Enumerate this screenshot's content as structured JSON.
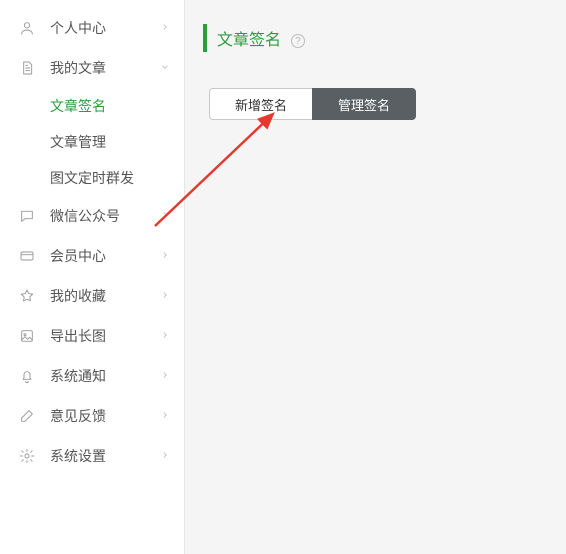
{
  "sidebar": {
    "items": [
      {
        "id": "personal-center",
        "label": "个人中心",
        "icon": "user",
        "chevron": "right",
        "sub": []
      },
      {
        "id": "my-articles",
        "label": "我的文章",
        "icon": "document",
        "chevron": "down",
        "sub": [
          {
            "id": "article-signature",
            "label": "文章签名",
            "active": true
          },
          {
            "id": "article-manage",
            "label": "文章管理",
            "active": false
          },
          {
            "id": "scheduled-mass",
            "label": "图文定时群发",
            "active": false
          }
        ]
      },
      {
        "id": "wechat-official",
        "label": "微信公众号",
        "icon": "chat",
        "chevron": "right",
        "sub": []
      },
      {
        "id": "member-center",
        "label": "会员中心",
        "icon": "card",
        "chevron": "right",
        "sub": []
      },
      {
        "id": "my-favorites",
        "label": "我的收藏",
        "icon": "star",
        "chevron": "right",
        "sub": []
      },
      {
        "id": "export-long-image",
        "label": "导出长图",
        "icon": "image",
        "chevron": "right",
        "sub": []
      },
      {
        "id": "system-notification",
        "label": "系统通知",
        "icon": "bell",
        "chevron": "right",
        "sub": []
      },
      {
        "id": "feedback",
        "label": "意见反馈",
        "icon": "edit",
        "chevron": "right",
        "sub": []
      },
      {
        "id": "system-settings",
        "label": "系统设置",
        "icon": "gear",
        "chevron": "right",
        "sub": []
      }
    ]
  },
  "main": {
    "page_title": "文章签名",
    "help_symbol": "?",
    "tab_add": "新增签名",
    "tab_manage": "管理签名"
  },
  "icons": {
    "user": "user-icon",
    "document": "document-icon",
    "chat": "chat-icon",
    "card": "card-icon",
    "star": "star-icon",
    "image": "image-icon",
    "bell": "bell-icon",
    "edit": "edit-icon",
    "gear": "gear-icon"
  },
  "colors": {
    "accent": "#2e9b3f",
    "highlight_border": "#e23b2e",
    "arrow": "#e23b2e",
    "tab_dark_bg": "#5a5f63"
  }
}
